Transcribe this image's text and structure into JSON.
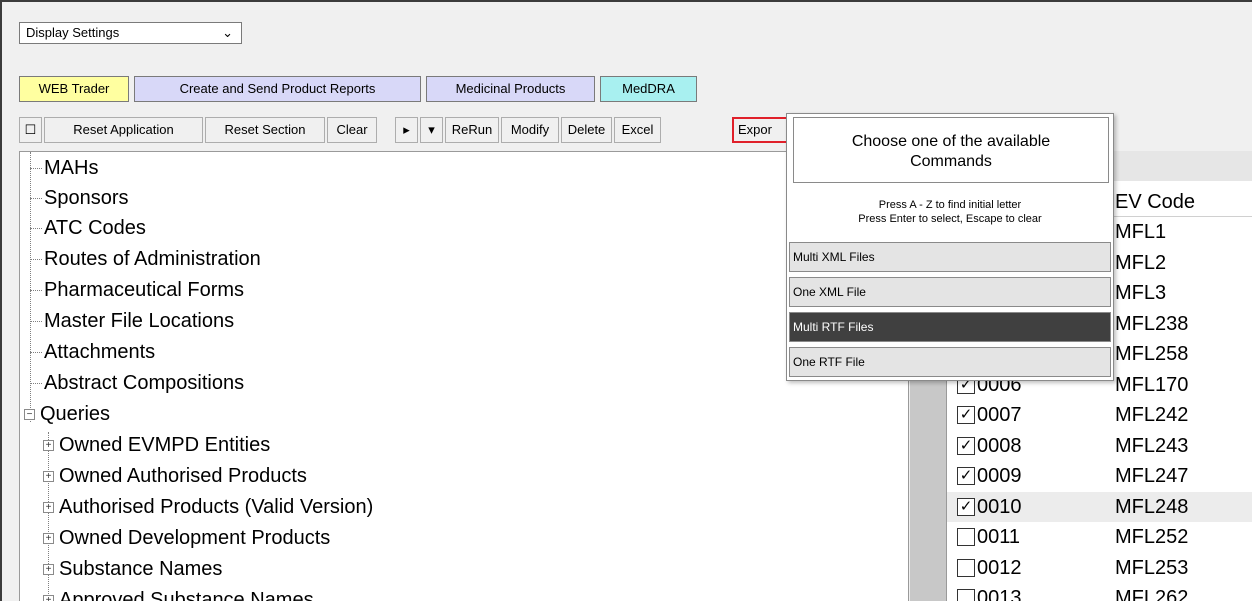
{
  "display_select": {
    "value": "Display Settings"
  },
  "tabs": [
    {
      "label": "WEB Trader",
      "color": "#ffffa0"
    },
    {
      "label": "Create and Send Product Reports",
      "color": "#d8d8f8"
    },
    {
      "label": "Medicinal Products",
      "color": "#d8d8f8"
    },
    {
      "label": "MedDRA",
      "color": "#a8f0f0"
    }
  ],
  "toolbar": {
    "toggle_glyph": "☐",
    "reset_application": "Reset Application",
    "reset_section": "Reset Section",
    "clear": "Clear",
    "play_glyph": "▸",
    "dropdown_glyph": "▾",
    "rerun": "ReRun",
    "modify": "Modify",
    "delete": "Delete",
    "excel": "Excel",
    "export": "Expor"
  },
  "tree": {
    "items": [
      {
        "label": "MAHs",
        "level": 1
      },
      {
        "label": "Sponsors",
        "level": 1
      },
      {
        "label": "ATC Codes",
        "level": 1
      },
      {
        "label": "Routes of Administration",
        "level": 1
      },
      {
        "label": "Pharmaceutical Forms",
        "level": 1
      },
      {
        "label": "Master File Locations",
        "level": 1
      },
      {
        "label": "Attachments",
        "level": 1
      },
      {
        "label": "Abstract Compositions",
        "level": 1
      },
      {
        "label": "Queries",
        "level": 0,
        "expander": "−"
      },
      {
        "label": "Owned EVMPD Entities",
        "level": 2,
        "expander": "+"
      },
      {
        "label": "Owned Authorised Products",
        "level": 2,
        "expander": "+"
      },
      {
        "label": "Authorised Products (Valid Version)",
        "level": 2,
        "expander": "+"
      },
      {
        "label": "Owned Development Products",
        "level": 2,
        "expander": "+"
      },
      {
        "label": "Substance Names",
        "level": 2,
        "expander": "+"
      },
      {
        "label": "Approved Substance Names",
        "level": 2,
        "expander": "+"
      }
    ]
  },
  "list": {
    "header_code": "EV Code",
    "rows": [
      {
        "num": "",
        "code": "MFL1",
        "checked": null
      },
      {
        "num": "",
        "code": "MFL2",
        "checked": null
      },
      {
        "num": "",
        "code": "MFL3",
        "checked": null
      },
      {
        "num": "",
        "code": "MFL238",
        "checked": null
      },
      {
        "num": "",
        "code": "MFL258",
        "checked": null
      },
      {
        "num": "0006",
        "code": "MFL170",
        "checked": true
      },
      {
        "num": "0007",
        "code": "MFL242",
        "checked": true
      },
      {
        "num": "0008",
        "code": "MFL243",
        "checked": true
      },
      {
        "num": "0009",
        "code": "MFL247",
        "checked": true
      },
      {
        "num": "0010",
        "code": "MFL248",
        "checked": true,
        "selected": true
      },
      {
        "num": "0011",
        "code": "MFL252",
        "checked": false
      },
      {
        "num": "0012",
        "code": "MFL253",
        "checked": false
      },
      {
        "num": "0013",
        "code": "MFL262",
        "checked": false
      }
    ]
  },
  "popup": {
    "title_line1": "Choose one of the available",
    "title_line2": "Commands",
    "hint_line1": "Press A - Z to find initial letter",
    "hint_line2": "Press Enter to select, Escape to clear",
    "options": [
      {
        "label": "Multi XML Files",
        "active": false
      },
      {
        "label": "One XML File",
        "active": false
      },
      {
        "label": "Multi RTF Files",
        "active": true
      },
      {
        "label": "One RTF File",
        "active": false
      }
    ]
  },
  "colors": {
    "export_highlight": "#e0202a",
    "active_option": "#404040"
  }
}
